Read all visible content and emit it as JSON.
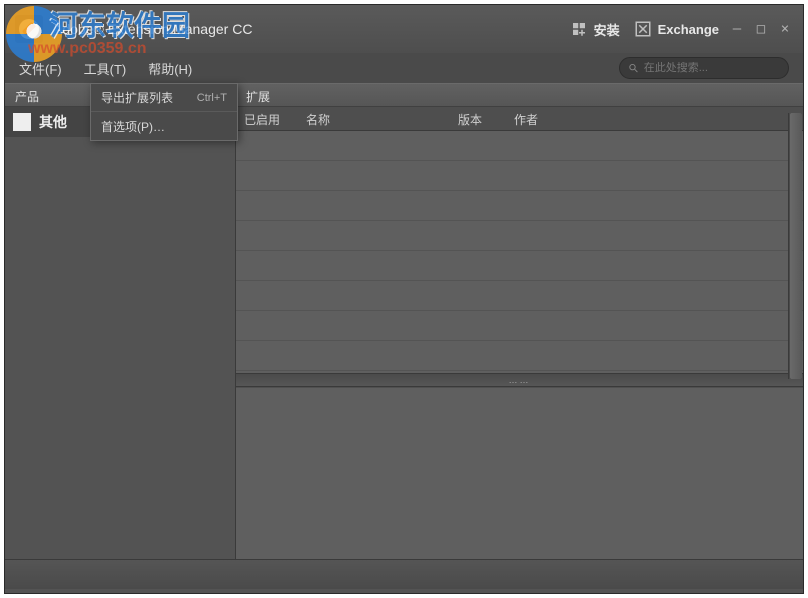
{
  "app": {
    "title": "Adobe® Extension Manager CC"
  },
  "titlebar": {
    "install": "安装",
    "exchange": "Exchange"
  },
  "menu": {
    "file": "文件(F)",
    "tools": "工具(T)",
    "help": "帮助(H)"
  },
  "search": {
    "placeholder": "在此处搜索..."
  },
  "headers": {
    "product": "产品",
    "extension": "扩展"
  },
  "sidebar": {
    "items": [
      {
        "label": "其他"
      }
    ]
  },
  "columns": {
    "enabled": "已启用",
    "name": "名称",
    "version": "版本",
    "author": "作者"
  },
  "dropdown": {
    "export": {
      "label": "导出扩展列表",
      "shortcut": "Ctrl+T"
    },
    "prefs": {
      "label": "首选项(P)…"
    }
  },
  "divider": "……",
  "watermark": {
    "site": "河东软件园",
    "url": "www.pc0359.cn"
  }
}
